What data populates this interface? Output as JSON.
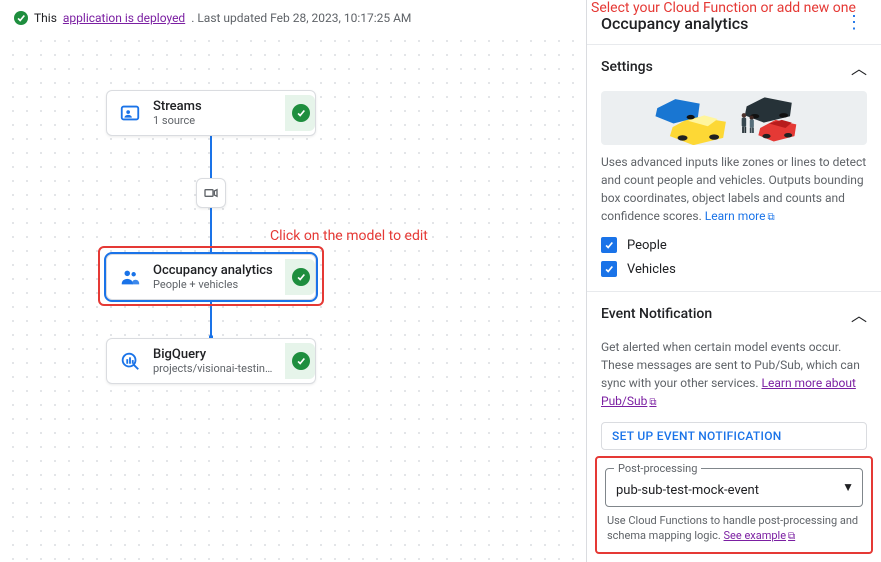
{
  "status": {
    "prefix": "This",
    "link_text": "application is deployed",
    "suffix": ". Last updated Feb 28, 2023, 10:17:25 AM"
  },
  "nodes": {
    "streams": {
      "title": "Streams",
      "sub": "1 source"
    },
    "occupancy": {
      "title": "Occupancy analytics",
      "sub": "People + vehicles"
    },
    "bigquery": {
      "title": "BigQuery",
      "sub": "projects/visionai-testing-stabl..."
    }
  },
  "annotations": {
    "edit_model": "Click on the model to edit",
    "select_cf": "Select your Cloud Function or add new one"
  },
  "panel": {
    "title": "Occupancy analytics",
    "settings_label": "Settings",
    "desc_text": "Uses advanced inputs like zones or lines to detect and count people and vehicles. Outputs bounding box coordinates, object labels and counts and confidence scores. ",
    "learn_more": "Learn more",
    "chk_people": "People",
    "chk_vehicles": "Vehicles",
    "event_label": "Event Notification",
    "event_desc": "Get alerted when certain model events occur. These messages are sent to Pub/Sub, which can sync with your other services. ",
    "event_link": "Learn more about Pub/Sub",
    "setup_btn": "SET UP EVENT NOTIFICATION",
    "post_proc_label": "Post-processing",
    "post_proc_value": "pub-sub-test-mock-event",
    "post_proc_help_a": "Use Cloud Functions to handle post-processing and schema mapping logic. ",
    "post_proc_help_link": "See example"
  }
}
